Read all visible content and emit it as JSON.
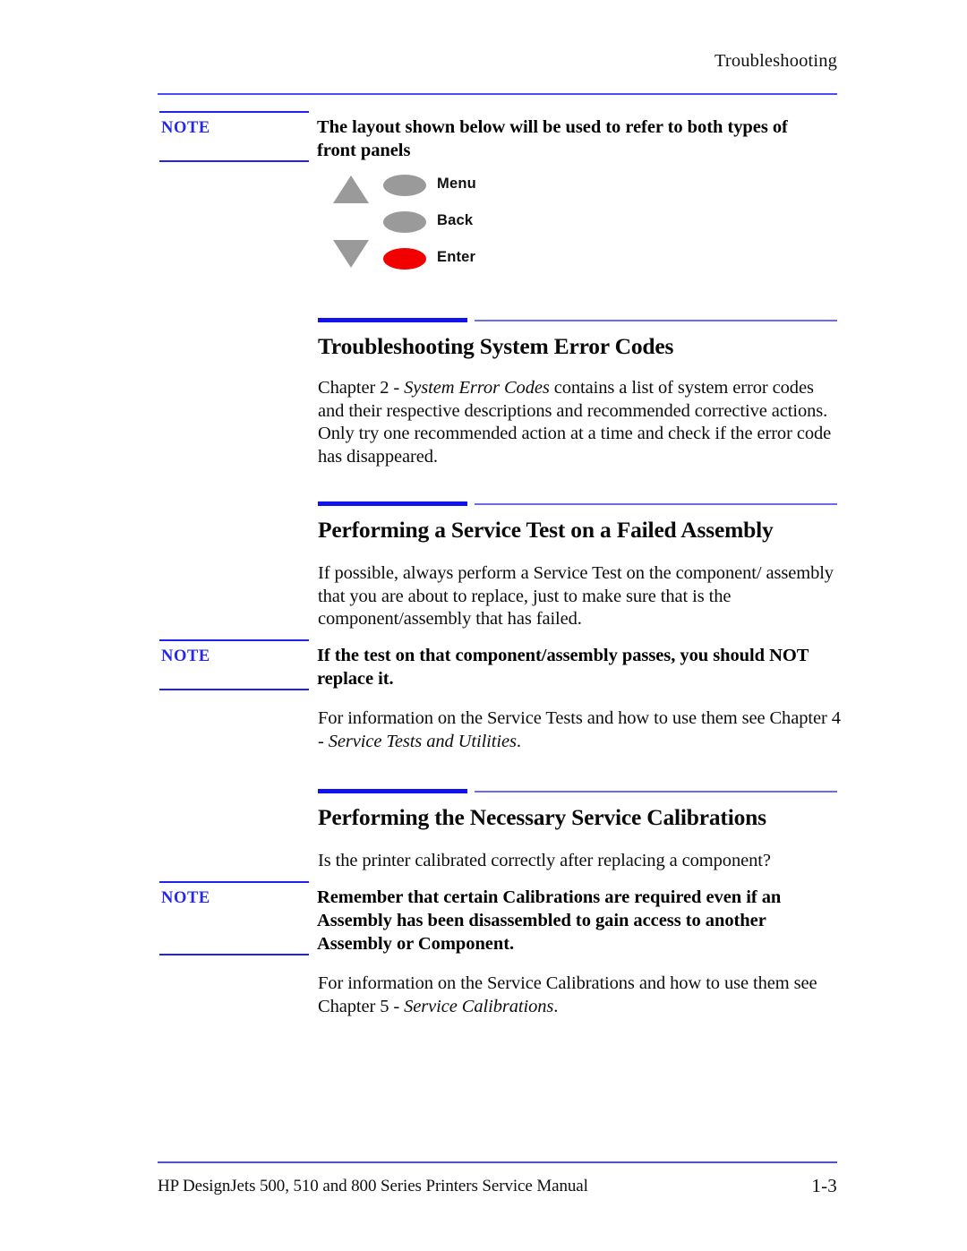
{
  "page": {
    "running_header": "Troubleshooting",
    "footer_left": "HP DesignJets 500, 510 and 800 Series Printers Service Manual",
    "footer_page_number": "1-3"
  },
  "colors": {
    "rule_blue_thin": "#4a4aff",
    "rule_blue_thick": "#1212ee",
    "rule_blue_light": "#6b6bf0",
    "note_label": "#2727e6",
    "button_gray": "#9a9a9a",
    "button_red": "#f20000",
    "text": "#000000"
  },
  "notes": [
    {
      "label": "NOTE",
      "body_line1": "The layout shown below will be used to refer to both types of",
      "body_line2": "front panels"
    },
    {
      "label": "NOTE",
      "body_line1": "If the test on that component/assembly passes, you should NOT",
      "body_line2": "replace it."
    },
    {
      "label": "NOTE",
      "body_line1": "Remember that certain Calibrations are required even if an",
      "body_line2": "Assembly has been disassembled to gain access to another",
      "body_line3": "Assembly or Component."
    }
  ],
  "front_panel": {
    "up_arrow_icon": "triangle-up-icon",
    "down_arrow_icon": "triangle-down-icon",
    "buttons": [
      {
        "label": "Menu",
        "shape": "ellipse",
        "color": "#9a9a9a"
      },
      {
        "label": "Back",
        "shape": "ellipse",
        "color": "#9a9a9a"
      },
      {
        "label": "Enter",
        "shape": "ellipse",
        "color": "#f20000"
      }
    ]
  },
  "sections": [
    {
      "title": "Troubleshooting System Error Codes",
      "paragraph_parts": {
        "lead": "Chapter 2 - ",
        "italic": "System Error Codes",
        "rest": " contains a list of system error codes and their respective descriptions and recommended corrective actions. Only try one recommended action at a time and check if the error code has disappeared."
      }
    },
    {
      "title": "Performing a Service Test on a Failed Assembly",
      "paragraph": "If possible, always perform a Service Test on the component/ assembly that you are about to replace, just to make sure that is the component/assembly that has failed.",
      "followup_parts": {
        "lead": "For information on the Service Tests and how to use them see Chapter 4 - ",
        "italic": "Service Tests and Utilities",
        "rest": "."
      }
    },
    {
      "title": "Performing the Necessary Service Calibrations",
      "paragraph": "Is the printer calibrated correctly after replacing a component?",
      "followup_parts": {
        "lead": "For information on the Service Calibrations and how to use them see Chapter 5 - ",
        "italic": "Service Calibrations",
        "rest": "."
      }
    }
  ]
}
